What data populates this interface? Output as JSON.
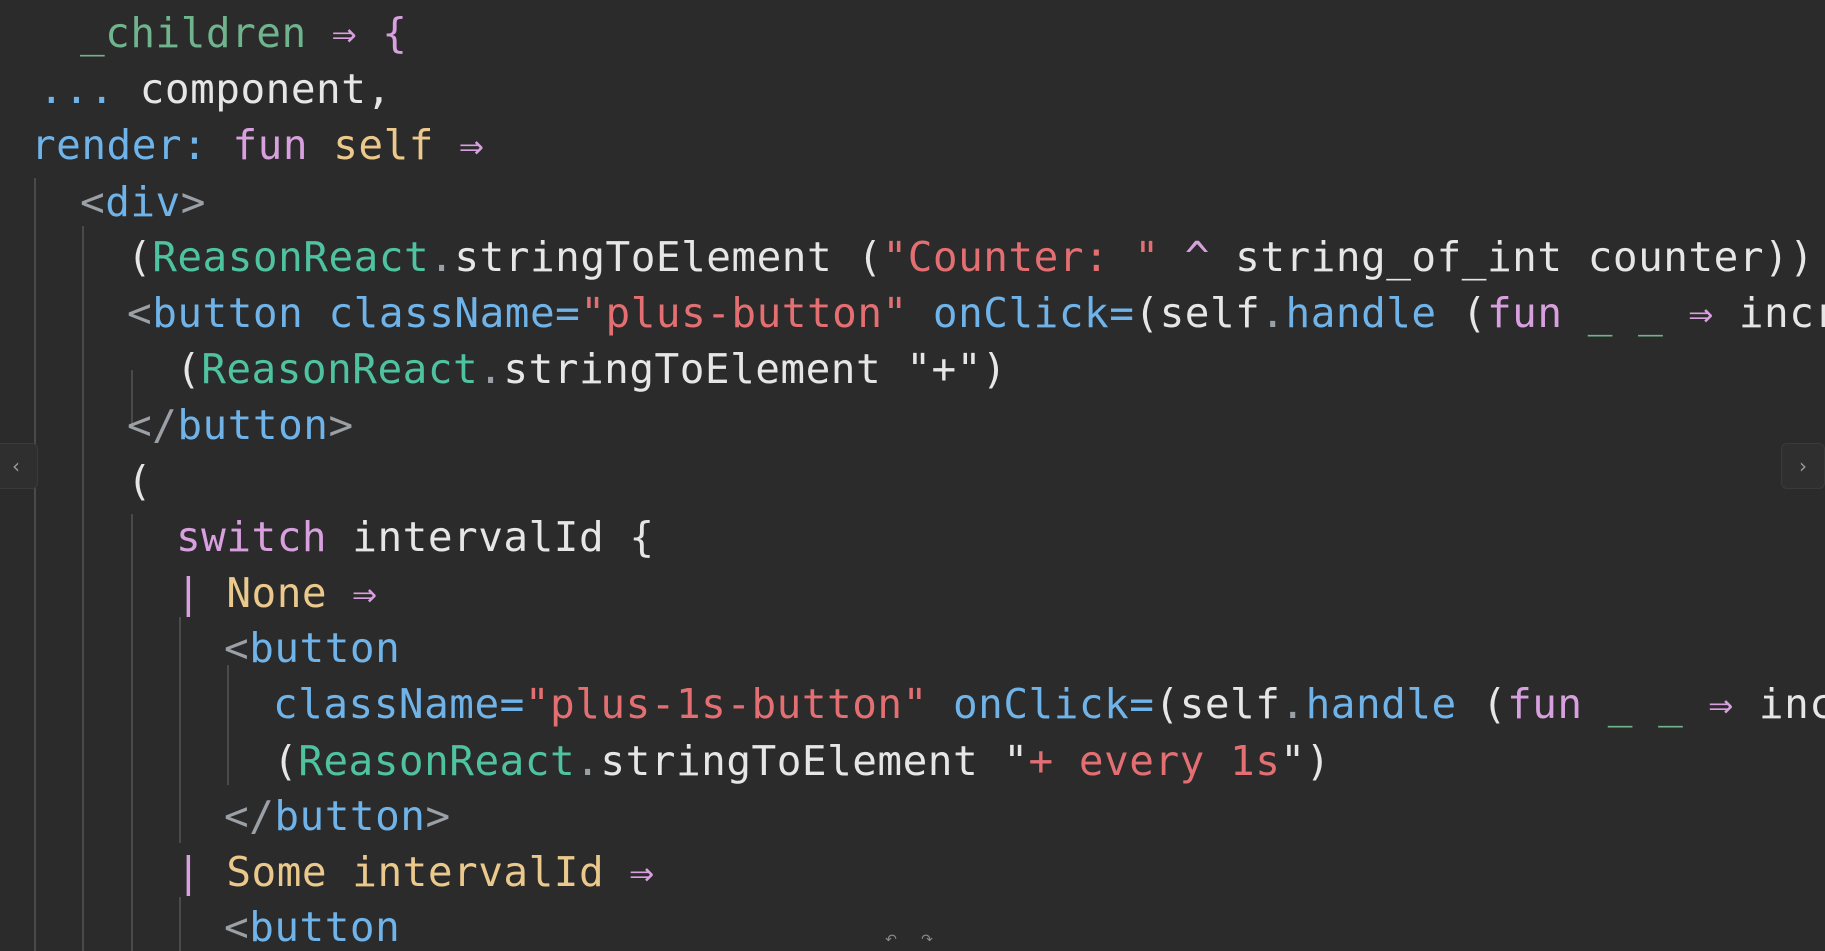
{
  "code_lines": [
    [
      {
        "t": "_children",
        "c": "t-dim"
      },
      {
        "t": " ⇒ {",
        "c": "t-op"
      }
    ],
    [
      {
        "t": "...",
        "c": "t-fn"
      },
      {
        "t": " component,",
        "c": "t-plain"
      }
    ],
    [
      {
        "t": "render:",
        "c": "t-fn"
      },
      {
        "t": " fun",
        "c": "t-kw"
      },
      {
        "t": " self",
        "c": "t-var"
      },
      {
        "t": " ⇒",
        "c": "t-op"
      }
    ],
    [
      {
        "t": "<",
        "c": "t-punc"
      },
      {
        "t": "div",
        "c": "t-fn"
      },
      {
        "t": ">",
        "c": "t-punc"
      }
    ],
    [
      {
        "t": "(",
        "c": "t-plain"
      },
      {
        "t": "ReasonReact",
        "c": "t-mod"
      },
      {
        "t": ".",
        "c": "t-punc"
      },
      {
        "t": "stringToElement",
        "c": "t-plain"
      },
      {
        "t": " (",
        "c": "t-plain"
      },
      {
        "t": "\"Counter: \"",
        "c": "t-str"
      },
      {
        "t": " ^",
        "c": "t-op"
      },
      {
        "t": " string_of_int counter))",
        "c": "t-plain"
      }
    ],
    [
      {
        "t": "<",
        "c": "t-punc"
      },
      {
        "t": "button",
        "c": "t-fn"
      },
      {
        "t": " className=",
        "c": "t-fn"
      },
      {
        "t": "\"plus-button\"",
        "c": "t-str"
      },
      {
        "t": " onClick=",
        "c": "t-fn"
      },
      {
        "t": "(self",
        "c": "t-plain"
      },
      {
        "t": ".",
        "c": "t-punc"
      },
      {
        "t": "handle",
        "c": "t-fn"
      },
      {
        "t": " (",
        "c": "t-plain"
      },
      {
        "t": "fun",
        "c": "t-kw"
      },
      {
        "t": " _ _",
        "c": "t-dim"
      },
      {
        "t": " ⇒",
        "c": "t-op"
      },
      {
        "t": " incre",
        "c": "t-plain"
      }
    ],
    [
      {
        "t": "(",
        "c": "t-plain"
      },
      {
        "t": "ReasonReact",
        "c": "t-mod"
      },
      {
        "t": ".",
        "c": "t-punc"
      },
      {
        "t": "stringToElement",
        "c": "t-plain"
      },
      {
        "t": " \"+\")",
        "c": "t-plain"
      }
    ],
    [
      {
        "t": "</",
        "c": "t-punc"
      },
      {
        "t": "button",
        "c": "t-fn"
      },
      {
        "t": ">",
        "c": "t-punc"
      }
    ],
    [
      {
        "t": "(",
        "c": "t-plain"
      }
    ],
    [
      {
        "t": "switch",
        "c": "t-kw"
      },
      {
        "t": " intervalId {",
        "c": "t-plain"
      }
    ],
    [
      {
        "t": "|",
        "c": "t-op"
      },
      {
        "t": " None",
        "c": "t-var"
      },
      {
        "t": " ⇒",
        "c": "t-op"
      }
    ],
    [
      {
        "t": "<",
        "c": "t-punc"
      },
      {
        "t": "button",
        "c": "t-fn"
      }
    ],
    [
      {
        "t": "className=",
        "c": "t-fn"
      },
      {
        "t": "\"plus-1s-button\"",
        "c": "t-str"
      },
      {
        "t": " onClick=",
        "c": "t-fn"
      },
      {
        "t": "(self",
        "c": "t-plain"
      },
      {
        "t": ".",
        "c": "t-punc"
      },
      {
        "t": "handle",
        "c": "t-fn"
      },
      {
        "t": " (",
        "c": "t-plain"
      },
      {
        "t": "fun",
        "c": "t-kw"
      },
      {
        "t": " _ _",
        "c": "t-dim"
      },
      {
        "t": " ⇒",
        "c": "t-op"
      },
      {
        "t": " incr",
        "c": "t-plain"
      }
    ],
    [
      {
        "t": "(",
        "c": "t-plain"
      },
      {
        "t": "ReasonReact",
        "c": "t-mod"
      },
      {
        "t": ".",
        "c": "t-punc"
      },
      {
        "t": "stringToElement",
        "c": "t-plain"
      },
      {
        "t": " \"",
        "c": "t-plain"
      },
      {
        "t": "+ every 1s",
        "c": "t-str"
      },
      {
        "t": "\")",
        "c": "t-plain"
      }
    ],
    [
      {
        "t": "</",
        "c": "t-punc"
      },
      {
        "t": "button",
        "c": "t-fn"
      },
      {
        "t": ">",
        "c": "t-punc"
      }
    ],
    [
      {
        "t": "|",
        "c": "t-op"
      },
      {
        "t": " Some",
        "c": "t-var"
      },
      {
        "t": " intervalId",
        "c": "t-var"
      },
      {
        "t": " ⇒",
        "c": "t-op"
      }
    ],
    [
      {
        "t": "<",
        "c": "t-punc"
      },
      {
        "t": "button",
        "c": "t-fn"
      }
    ]
  ],
  "controls": {
    "nav_left_glyph": "‹",
    "nav_right_glyph": "›",
    "undo_glyph": "↶",
    "redo_glyph": "↷"
  }
}
